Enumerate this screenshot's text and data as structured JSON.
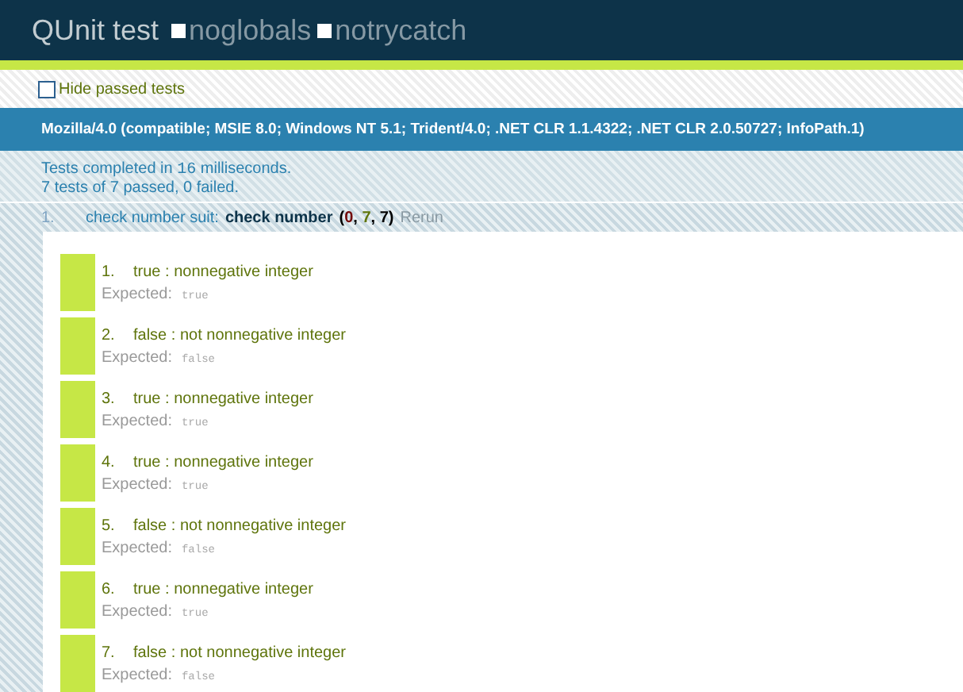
{
  "header": {
    "title": "QUnit test",
    "options": [
      {
        "label": "noglobals",
        "checked": false
      },
      {
        "label": "notrycatch",
        "checked": false
      }
    ]
  },
  "toolbar": {
    "hide_passed": {
      "label": "Hide passed tests",
      "checked": false
    }
  },
  "user_agent": "Mozilla/4.0 (compatible; MSIE 8.0; Windows NT 5.1; Trident/4.0; .NET CLR 1.1.4322; .NET CLR 2.0.50727; InfoPath.1)",
  "summary": {
    "line_1_before": "Tests completed in ",
    "duration": "16",
    "line_1_after": " milliseconds.",
    "line_2": "7 tests of 7 passed, 0 failed."
  },
  "tests": [
    {
      "number": "1.",
      "module": "check number suit:",
      "name": "check number",
      "counts_open": "(",
      "failed": "0",
      "counts_separator": ", ",
      "passed": "7",
      "total": "7",
      "counts_close": ")",
      "rerun": "Rerun",
      "passed_state": true,
      "assertions": [
        {
          "number": "1.",
          "message": "true : nonnegative integer",
          "expected_label": "Expected:",
          "expected": "true",
          "passed": true
        },
        {
          "number": "2.",
          "message": "false : not nonnegative integer",
          "expected_label": "Expected:",
          "expected": "false",
          "passed": true
        },
        {
          "number": "3.",
          "message": "true : nonnegative integer",
          "expected_label": "Expected:",
          "expected": "true",
          "passed": true
        },
        {
          "number": "4.",
          "message": "true : nonnegative integer",
          "expected_label": "Expected:",
          "expected": "true",
          "passed": true
        },
        {
          "number": "5.",
          "message": "false : not nonnegative integer",
          "expected_label": "Expected:",
          "expected": "false",
          "passed": true
        },
        {
          "number": "6.",
          "message": "true : nonnegative integer",
          "expected_label": "Expected:",
          "expected": "true",
          "passed": true
        },
        {
          "number": "7.",
          "message": "false : not nonnegative integer",
          "expected_label": "Expected:",
          "expected": "false",
          "passed": true
        }
      ]
    }
  ]
}
